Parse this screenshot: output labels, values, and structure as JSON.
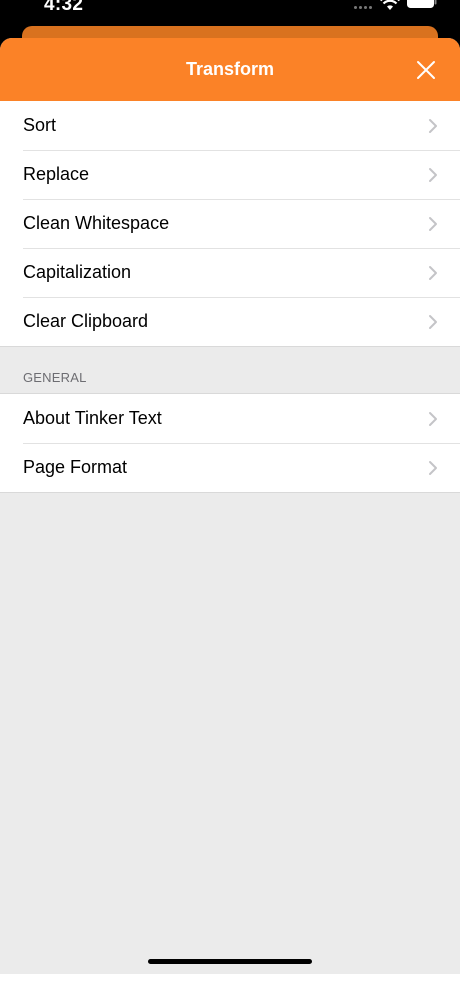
{
  "status_bar": {
    "time": "4:32"
  },
  "nav": {
    "title": "Transform"
  },
  "transform_items": [
    {
      "label": "Sort"
    },
    {
      "label": "Replace"
    },
    {
      "label": "Clean Whitespace"
    },
    {
      "label": "Capitalization"
    },
    {
      "label": "Clear Clipboard"
    }
  ],
  "general": {
    "header": "GENERAL",
    "items": [
      {
        "label": "About Tinker Text"
      },
      {
        "label": "Page Format"
      }
    ]
  },
  "colors": {
    "accent": "#fb8227",
    "background": "#ebebeb",
    "chevron": "#c4c4c7"
  }
}
